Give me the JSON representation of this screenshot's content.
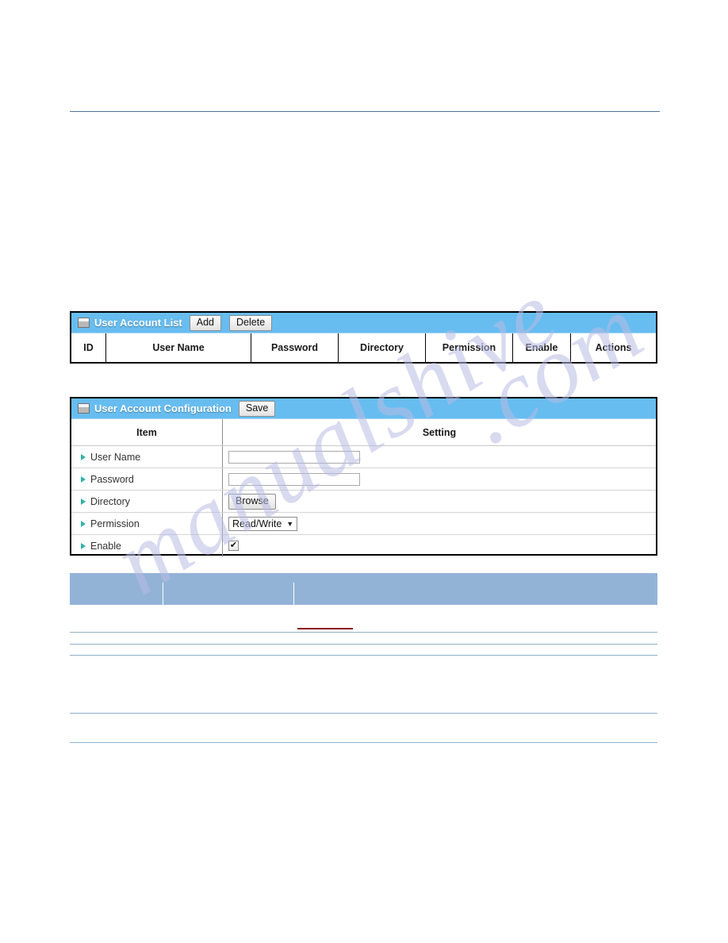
{
  "page": {
    "watermark_left": "manualshive",
    "watermark_right": ".com"
  },
  "user_account_list": {
    "title": "User Account List",
    "icon": "window-icon",
    "buttons": [
      {
        "label": "Add",
        "name": "add-button"
      },
      {
        "label": "Delete",
        "name": "delete-button"
      }
    ],
    "columns": [
      "ID",
      "User Name",
      "Password",
      "Directory",
      "Permission",
      "Enable",
      "Actions"
    ],
    "rows": []
  },
  "user_account_configuration": {
    "title": "User Account Configuration",
    "icon": "window-icon",
    "save_label": "Save",
    "header": {
      "item": "Item",
      "setting": "Setting"
    },
    "fields": [
      {
        "label": "User Name",
        "type": "text",
        "value": "",
        "placeholder": ""
      },
      {
        "label": "Password",
        "type": "text",
        "value": "",
        "placeholder": ""
      },
      {
        "label": "Directory",
        "type": "browse",
        "button_label": "Browse"
      },
      {
        "label": "Permission",
        "type": "select",
        "value": "Read/Write",
        "caret": "▼"
      },
      {
        "label": "Enable",
        "type": "checkbox",
        "checked": true,
        "check_glyph": "✔"
      }
    ]
  },
  "colors": {
    "panel_header": "#67bdf0",
    "spec_header": "#93b3d6",
    "panel_border": "#000000",
    "bullet": "#2fb3a6",
    "rule": "#4f7296",
    "red_underline": "#8b1a1a",
    "watermark": "#b9bce4"
  }
}
